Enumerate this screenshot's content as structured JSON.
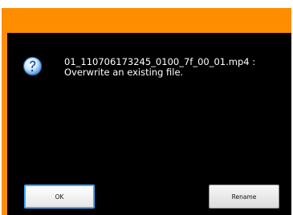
{
  "dialog": {
    "filename": "01_110706173245_0100_7f_00_01.mp4 :",
    "message": "Overwrite an existing file.",
    "icon": "question-icon",
    "buttons": {
      "ok_label": "OK",
      "rename_label": "Rename"
    }
  },
  "colors": {
    "accent": "#ff8d00",
    "background": "#000000",
    "text": "#ffffff",
    "focus": "#3fa7ff"
  }
}
